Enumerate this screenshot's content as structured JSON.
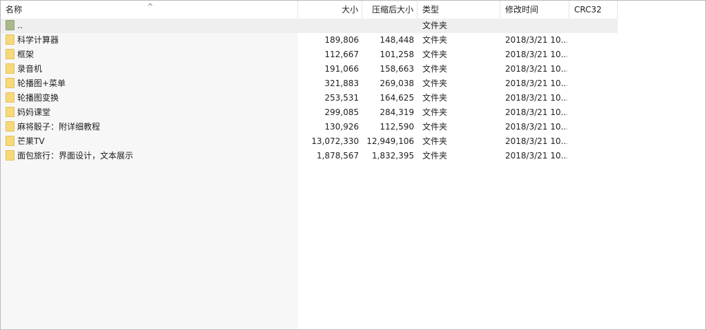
{
  "columns": {
    "name": "名称",
    "size": "大小",
    "packed": "压缩后大小",
    "type": "类型",
    "modified": "修改时间",
    "crc": "CRC32"
  },
  "sort_indicator": "^",
  "rows": [
    {
      "name": "..",
      "size": "",
      "packed": "",
      "type": "文件夹",
      "modified": "",
      "crc": "",
      "icon": "folder-up-icon"
    },
    {
      "name": "科学计算器",
      "size": "189,806",
      "packed": "148,448",
      "type": "文件夹",
      "modified": "2018/3/21 10...",
      "crc": "",
      "icon": "folder-icon"
    },
    {
      "name": "框架",
      "size": "112,667",
      "packed": "101,258",
      "type": "文件夹",
      "modified": "2018/3/21 10...",
      "crc": "",
      "icon": "folder-icon"
    },
    {
      "name": "录音机",
      "size": "191,066",
      "packed": "158,663",
      "type": "文件夹",
      "modified": "2018/3/21 10...",
      "crc": "",
      "icon": "folder-icon"
    },
    {
      "name": "轮播图+菜单",
      "size": "321,883",
      "packed": "269,038",
      "type": "文件夹",
      "modified": "2018/3/21 10...",
      "crc": "",
      "icon": "folder-icon"
    },
    {
      "name": "轮播图变换",
      "size": "253,531",
      "packed": "164,625",
      "type": "文件夹",
      "modified": "2018/3/21 10...",
      "crc": "",
      "icon": "folder-icon"
    },
    {
      "name": "妈妈课堂",
      "size": "299,085",
      "packed": "284,319",
      "type": "文件夹",
      "modified": "2018/3/21 10...",
      "crc": "",
      "icon": "folder-icon"
    },
    {
      "name": "麻将骰子：附详细教程",
      "size": "130,926",
      "packed": "112,590",
      "type": "文件夹",
      "modified": "2018/3/21 10...",
      "crc": "",
      "icon": "folder-icon"
    },
    {
      "name": "芒果TV",
      "size": "13,072,330",
      "packed": "12,949,106",
      "type": "文件夹",
      "modified": "2018/3/21 10...",
      "crc": "",
      "icon": "folder-icon"
    },
    {
      "name": "面包旅行：界面设计，文本展示",
      "size": "1,878,567",
      "packed": "1,832,395",
      "type": "文件夹",
      "modified": "2018/3/21 10...",
      "crc": "",
      "icon": "folder-icon"
    }
  ]
}
